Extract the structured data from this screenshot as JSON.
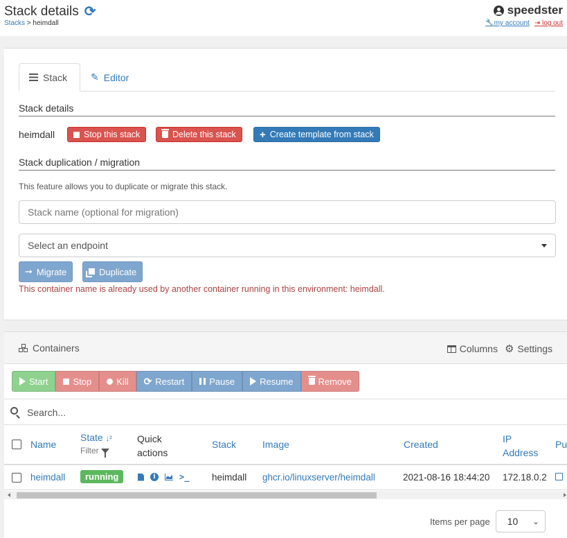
{
  "header": {
    "title": "Stack details",
    "breadcrumb_parent": "Stacks",
    "breadcrumb_sep": " > ",
    "breadcrumb_current": "heimdall",
    "username": "speedster",
    "my_account": "my account",
    "log_out": "log out"
  },
  "tabs": {
    "stack": "Stack",
    "editor": "Editor"
  },
  "stack_details": {
    "section_title": "Stack details",
    "stack_name": "heimdall",
    "stop_label": "Stop this stack",
    "delete_label": "Delete this stack",
    "template_label": "Create template from stack"
  },
  "duplication": {
    "section_title": "Stack duplication / migration",
    "help_text": "This feature allows you to duplicate or migrate this stack.",
    "name_placeholder": "Stack name (optional for migration)",
    "endpoint_select": "Select an endpoint",
    "migrate_label": "Migrate",
    "duplicate_label": "Duplicate",
    "error_text": "This container name is already used by another container running in this environment: heimdall."
  },
  "containers": {
    "title": "Containers",
    "columns_label": "Columns",
    "settings_label": "Settings",
    "actions": {
      "start": "Start",
      "stop": "Stop",
      "kill": "Kill",
      "restart": "Restart",
      "pause": "Pause",
      "resume": "Resume",
      "remove": "Remove"
    },
    "search_placeholder": "Search...",
    "headers": {
      "name": "Name",
      "state": "State",
      "filter": "Filter",
      "quick_actions_1": "Quick",
      "quick_actions_2": "actions",
      "stack": "Stack",
      "image": "Image",
      "created": "Created",
      "ip_1": "IP",
      "ip_2": "Address",
      "published": "Pu"
    },
    "rows": [
      {
        "name": "heimdall",
        "state": "running",
        "stack": "heimdall",
        "image": "ghcr.io/linuxserver/heimdall",
        "created": "2021-08-16 18:44:20",
        "ip": "172.18.0.2"
      }
    ],
    "pagination": {
      "items_per_page_label": "Items per page",
      "items_per_page": "10"
    }
  },
  "colors": {
    "primary": "#337ab7",
    "danger": "#d9534f",
    "success": "#5cb85c",
    "error_text": "#a94442"
  }
}
